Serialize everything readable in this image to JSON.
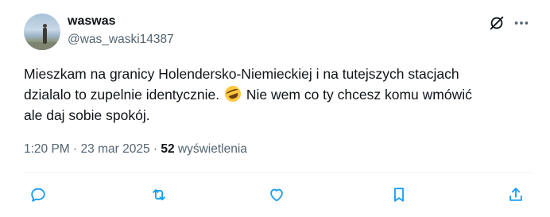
{
  "author": {
    "display_name": "waswas",
    "handle": "@was_waski14387",
    "avatar_icon": "avatar-photo"
  },
  "header_actions": {
    "grok_icon": "grok-icon",
    "more_icon": "more-icon"
  },
  "tweet": {
    "text_line1": "Mieszkam na granicy Holendersko-Niemieckiej i na tutejszych stacjach",
    "text_line2_before_emoji": "dzialalo to zupelnie identycznie.",
    "emoji_name": "rolling-on-the-floor-laughing-emoji",
    "text_line2_after_emoji": "Nie wem co ty chcesz komu wmówić",
    "text_line3": "ale daj sobie spokój."
  },
  "meta": {
    "time": "1:20 PM",
    "separator": "·",
    "date": "23 mar 2025",
    "views_count": "52",
    "views_label": "wyświetlenia"
  },
  "actions": {
    "reply_icon": "reply-icon",
    "retweet_icon": "retweet-icon",
    "like_icon": "like-icon",
    "bookmark_icon": "bookmark-icon",
    "share_icon": "share-icon"
  },
  "colors": {
    "text": "#0f1419",
    "secondary": "#536471",
    "action_icon": "#1d9bf0",
    "divider": "#eff3f4"
  }
}
